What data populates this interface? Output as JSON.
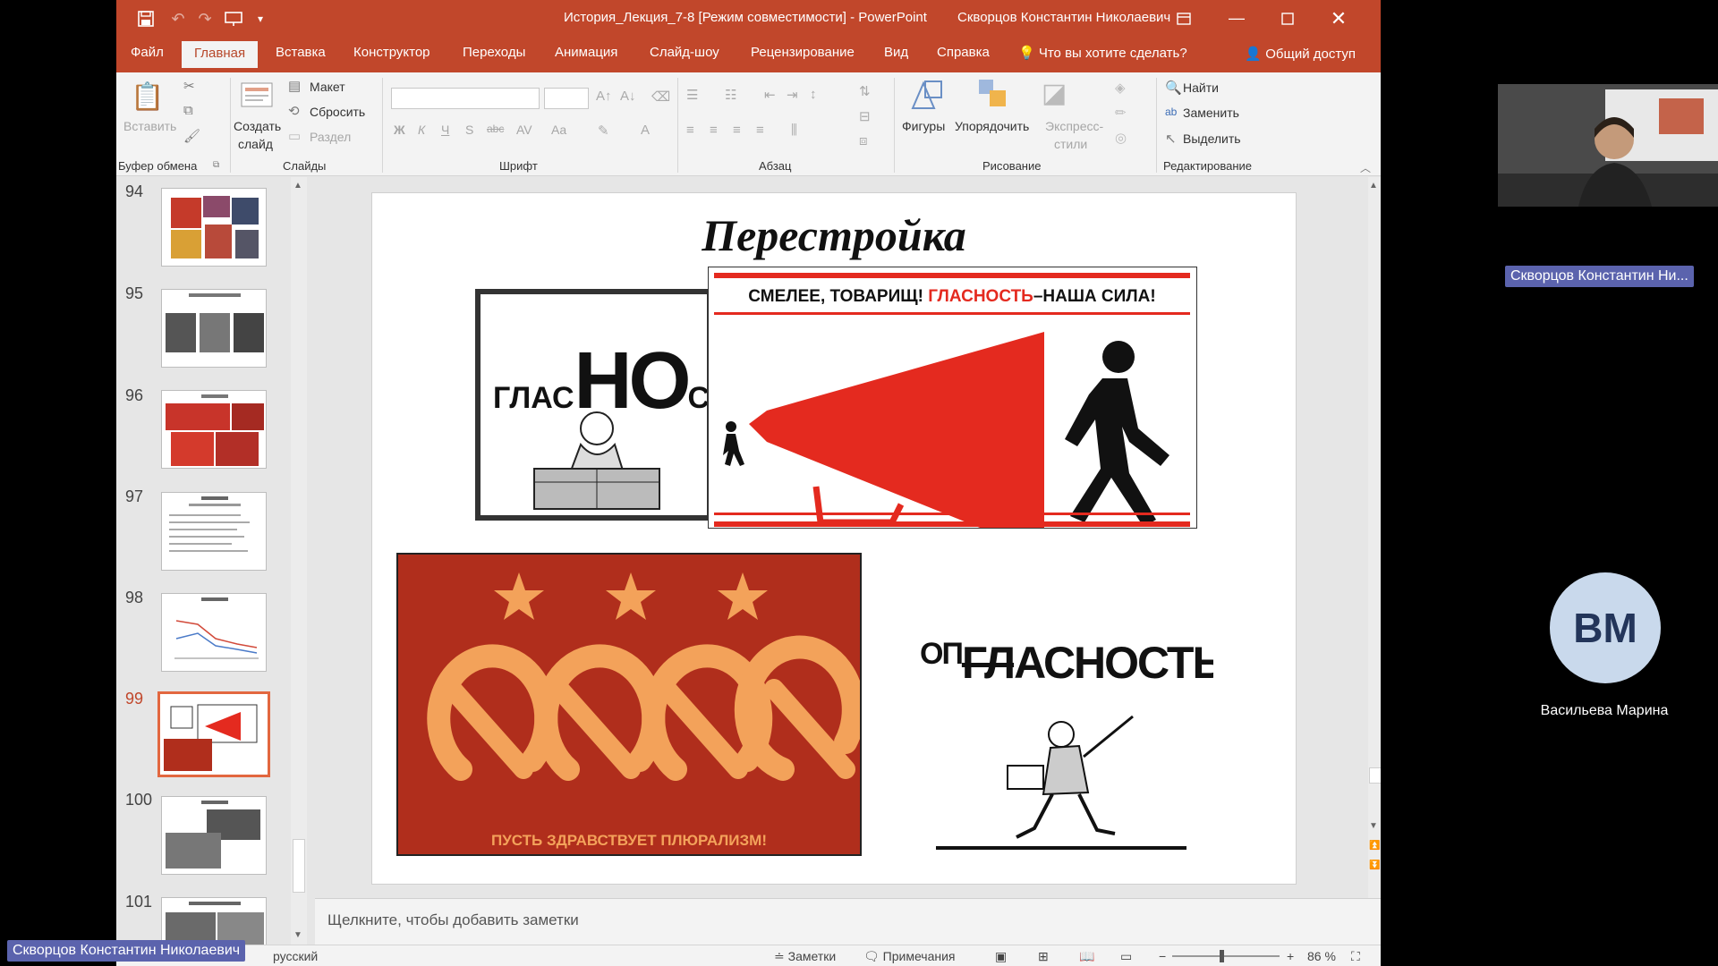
{
  "window": {
    "title": "История_Лекция_7-8 [Режим совместимости]  -  PowerPoint",
    "user": "Скворцов Константин Николаевич"
  },
  "tabs": [
    "Файл",
    "Главная",
    "Вставка",
    "Конструктор",
    "Переходы",
    "Анимация",
    "Слайд-шоу",
    "Рецензирование",
    "Вид",
    "Справка"
  ],
  "tell_me": "Что вы хотите сделать?",
  "share": "Общий доступ",
  "ribbon": {
    "clipboard": {
      "paste": "Вставить",
      "label": "Буфер обмена"
    },
    "slides": {
      "new_slide_1": "Создать",
      "new_slide_2": "слайд",
      "layout": "Макет",
      "reset": "Сбросить",
      "section": "Раздел",
      "label": "Слайды"
    },
    "font": {
      "label": "Шрифт",
      "bold": "Ж",
      "italic": "К",
      "underline": "Ч",
      "strike": "S",
      "abc": "abc",
      "av": "AV",
      "aa": "Aa"
    },
    "paragraph": {
      "label": "Абзац"
    },
    "drawing": {
      "shapes": "Фигуры",
      "arrange": "Упорядочить",
      "quick_1": "Экспресс-",
      "quick_2": "стили",
      "label": "Рисование"
    },
    "editing": {
      "find": "Найти",
      "replace": "Заменить",
      "select": "Выделить",
      "label": "Редактирование"
    }
  },
  "slides_panel": {
    "numbers": [
      "94",
      "95",
      "96",
      "97",
      "98",
      "99",
      "100",
      "101"
    ],
    "selected": "99"
  },
  "slide": {
    "title": "Перестройка",
    "poster_megaphone_text_a": "СМЕЛЕЕ, ТОВАРИЩ!",
    "poster_megaphone_text_b": "ГЛАСНОСТЬ",
    "poster_megaphone_text_c": "–НАША СИЛА!",
    "poster_glasnost_a": "ГЛАС",
    "poster_glasnost_b": "НО",
    "poster_glasnost_c": "СТЬ!",
    "poster_pluralism": "ПУСТЬ ЗДРАВСТВУЕТ ПЛЮРАЛИЗМ!",
    "poster_opasnost_a": "ОП",
    "poster_opasnost_b": "ГЛ",
    "poster_opasnost_c": "АСНОСТЬ"
  },
  "notes_placeholder": "Щелкните, чтобы добавить заметки",
  "status": {
    "language": "русский",
    "notes": "Заметки",
    "comments": "Примечания",
    "zoom": "86 %"
  },
  "meeting": {
    "presenter_tag": "Скворцов Константин Ни...",
    "bottom_tag": "Скворцов Константин Николаевич",
    "avatar_initials": "ВМ",
    "avatar_name": "Васильева Марина"
  },
  "colors": {
    "titlebar": "#c1472b",
    "poster_red": "#e42a1f",
    "pluralism_bg": "#b02e1c",
    "pluralism_fg": "#f3a25a",
    "meeting_tag": "#5b63ad"
  }
}
